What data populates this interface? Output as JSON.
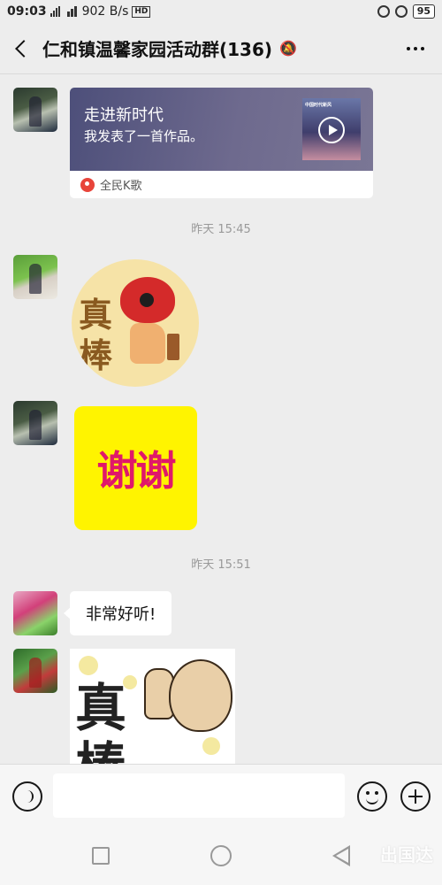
{
  "status_bar": {
    "time": "09:03",
    "net_speed": "902 B/s",
    "hd_label": "HD",
    "battery": "95"
  },
  "header": {
    "title": "仁和镇温馨家园活动群(136)",
    "mute_icon": "bell-off-icon",
    "more_icon": "more-dots-icon"
  },
  "messages": {
    "card": {
      "title": "走进新时代",
      "subtitle": "我发表了一首作品。",
      "thumb_text": "中国时代新风",
      "source": "全民K歌"
    },
    "timestamp1": "昨天 15:45",
    "sticker_zhenbang_1": {
      "line1": "真",
      "line2": "棒"
    },
    "sticker_xiexie": "谢谢",
    "timestamp2": "昨天 15:51",
    "text_bubble": "非常好听!",
    "sticker_zhenbang_2": {
      "line1": "真",
      "line2": "棒"
    }
  },
  "input_bar": {
    "placeholder": "",
    "voice_icon": "voice-icon",
    "emoji_icon": "emoji-icon",
    "plus_icon": "plus-icon"
  },
  "nav_bar": {
    "watermark": "出国达"
  }
}
